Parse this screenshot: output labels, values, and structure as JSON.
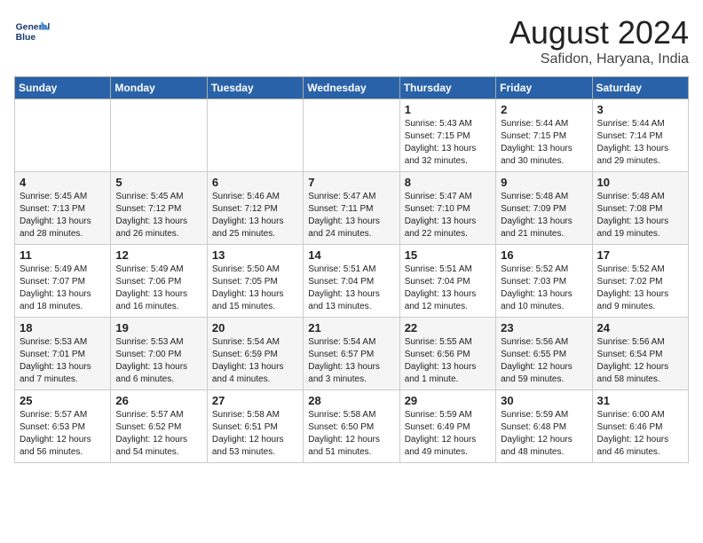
{
  "header": {
    "logo_line1": "General",
    "logo_line2": "Blue",
    "month": "August 2024",
    "location": "Safidon, Haryana, India"
  },
  "weekdays": [
    "Sunday",
    "Monday",
    "Tuesday",
    "Wednesday",
    "Thursday",
    "Friday",
    "Saturday"
  ],
  "weeks": [
    [
      {
        "day": "",
        "info": ""
      },
      {
        "day": "",
        "info": ""
      },
      {
        "day": "",
        "info": ""
      },
      {
        "day": "",
        "info": ""
      },
      {
        "day": "1",
        "info": "Sunrise: 5:43 AM\nSunset: 7:15 PM\nDaylight: 13 hours\nand 32 minutes."
      },
      {
        "day": "2",
        "info": "Sunrise: 5:44 AM\nSunset: 7:15 PM\nDaylight: 13 hours\nand 30 minutes."
      },
      {
        "day": "3",
        "info": "Sunrise: 5:44 AM\nSunset: 7:14 PM\nDaylight: 13 hours\nand 29 minutes."
      }
    ],
    [
      {
        "day": "4",
        "info": "Sunrise: 5:45 AM\nSunset: 7:13 PM\nDaylight: 13 hours\nand 28 minutes."
      },
      {
        "day": "5",
        "info": "Sunrise: 5:45 AM\nSunset: 7:12 PM\nDaylight: 13 hours\nand 26 minutes."
      },
      {
        "day": "6",
        "info": "Sunrise: 5:46 AM\nSunset: 7:12 PM\nDaylight: 13 hours\nand 25 minutes."
      },
      {
        "day": "7",
        "info": "Sunrise: 5:47 AM\nSunset: 7:11 PM\nDaylight: 13 hours\nand 24 minutes."
      },
      {
        "day": "8",
        "info": "Sunrise: 5:47 AM\nSunset: 7:10 PM\nDaylight: 13 hours\nand 22 minutes."
      },
      {
        "day": "9",
        "info": "Sunrise: 5:48 AM\nSunset: 7:09 PM\nDaylight: 13 hours\nand 21 minutes."
      },
      {
        "day": "10",
        "info": "Sunrise: 5:48 AM\nSunset: 7:08 PM\nDaylight: 13 hours\nand 19 minutes."
      }
    ],
    [
      {
        "day": "11",
        "info": "Sunrise: 5:49 AM\nSunset: 7:07 PM\nDaylight: 13 hours\nand 18 minutes."
      },
      {
        "day": "12",
        "info": "Sunrise: 5:49 AM\nSunset: 7:06 PM\nDaylight: 13 hours\nand 16 minutes."
      },
      {
        "day": "13",
        "info": "Sunrise: 5:50 AM\nSunset: 7:05 PM\nDaylight: 13 hours\nand 15 minutes."
      },
      {
        "day": "14",
        "info": "Sunrise: 5:51 AM\nSunset: 7:04 PM\nDaylight: 13 hours\nand 13 minutes."
      },
      {
        "day": "15",
        "info": "Sunrise: 5:51 AM\nSunset: 7:04 PM\nDaylight: 13 hours\nand 12 minutes."
      },
      {
        "day": "16",
        "info": "Sunrise: 5:52 AM\nSunset: 7:03 PM\nDaylight: 13 hours\nand 10 minutes."
      },
      {
        "day": "17",
        "info": "Sunrise: 5:52 AM\nSunset: 7:02 PM\nDaylight: 13 hours\nand 9 minutes."
      }
    ],
    [
      {
        "day": "18",
        "info": "Sunrise: 5:53 AM\nSunset: 7:01 PM\nDaylight: 13 hours\nand 7 minutes."
      },
      {
        "day": "19",
        "info": "Sunrise: 5:53 AM\nSunset: 7:00 PM\nDaylight: 13 hours\nand 6 minutes."
      },
      {
        "day": "20",
        "info": "Sunrise: 5:54 AM\nSunset: 6:59 PM\nDaylight: 13 hours\nand 4 minutes."
      },
      {
        "day": "21",
        "info": "Sunrise: 5:54 AM\nSunset: 6:57 PM\nDaylight: 13 hours\nand 3 minutes."
      },
      {
        "day": "22",
        "info": "Sunrise: 5:55 AM\nSunset: 6:56 PM\nDaylight: 13 hours\nand 1 minute."
      },
      {
        "day": "23",
        "info": "Sunrise: 5:56 AM\nSunset: 6:55 PM\nDaylight: 12 hours\nand 59 minutes."
      },
      {
        "day": "24",
        "info": "Sunrise: 5:56 AM\nSunset: 6:54 PM\nDaylight: 12 hours\nand 58 minutes."
      }
    ],
    [
      {
        "day": "25",
        "info": "Sunrise: 5:57 AM\nSunset: 6:53 PM\nDaylight: 12 hours\nand 56 minutes."
      },
      {
        "day": "26",
        "info": "Sunrise: 5:57 AM\nSunset: 6:52 PM\nDaylight: 12 hours\nand 54 minutes."
      },
      {
        "day": "27",
        "info": "Sunrise: 5:58 AM\nSunset: 6:51 PM\nDaylight: 12 hours\nand 53 minutes."
      },
      {
        "day": "28",
        "info": "Sunrise: 5:58 AM\nSunset: 6:50 PM\nDaylight: 12 hours\nand 51 minutes."
      },
      {
        "day": "29",
        "info": "Sunrise: 5:59 AM\nSunset: 6:49 PM\nDaylight: 12 hours\nand 49 minutes."
      },
      {
        "day": "30",
        "info": "Sunrise: 5:59 AM\nSunset: 6:48 PM\nDaylight: 12 hours\nand 48 minutes."
      },
      {
        "day": "31",
        "info": "Sunrise: 6:00 AM\nSunset: 6:46 PM\nDaylight: 12 hours\nand 46 minutes."
      }
    ]
  ]
}
